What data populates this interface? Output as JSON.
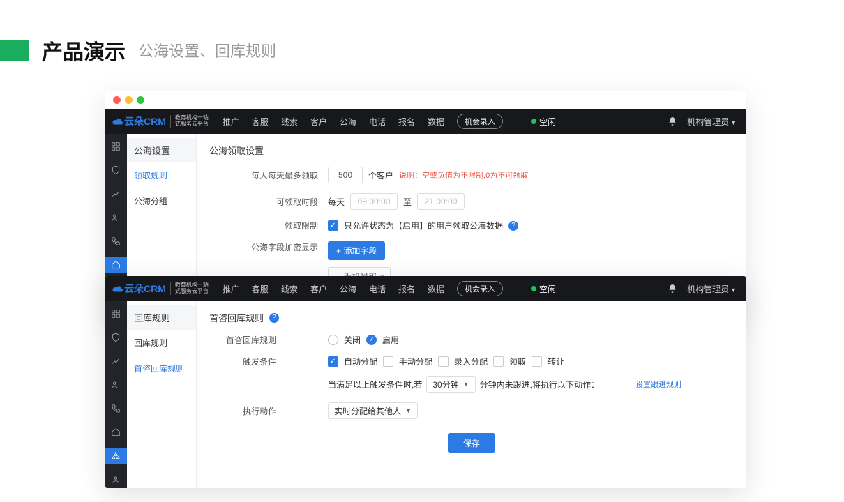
{
  "slide": {
    "title_main": "产品演示",
    "title_sub": "公海设置、回库规则"
  },
  "topnav": [
    "推广",
    "客服",
    "线索",
    "客户",
    "公海",
    "电话",
    "报名",
    "数据"
  ],
  "topnav_pill": "机会录入",
  "status_label": "空闲",
  "user_role": "机构管理员",
  "window1": {
    "sidepanel_title": "公海设置",
    "sidepanel_items": [
      {
        "label": "领取规则",
        "active": true
      },
      {
        "label": "公海分组",
        "active": false
      }
    ],
    "section_title": "公海领取设置",
    "row_limit_label": "每人每天最多领取",
    "row_limit_value": "500",
    "row_limit_unit": "个客户",
    "row_limit_note": "说明：空或负值为不限制,0为不可领取",
    "row_time_label": "可领取时段",
    "row_time_prefix": "每天",
    "row_time_from": "09:00:00",
    "row_time_to_label": "至",
    "row_time_to": "21:00:00",
    "row_restrict_label": "领取限制",
    "row_restrict_text": "只允许状态为【启用】的用户领取公海数据",
    "row_encrypt_label": "公海字段加密显示",
    "row_encrypt_btn": "+ 添加字段",
    "row_encrypt_chip": "手机号码"
  },
  "window2": {
    "sidepanel_title": "回库规则",
    "sidepanel_items": [
      {
        "label": "回库规则",
        "active": false
      },
      {
        "label": "首咨回库规则",
        "active": true
      }
    ],
    "section_title": "首咨回库规则",
    "row_enable_label": "首咨回库规则",
    "radio_off": "关闭",
    "radio_on": "启用",
    "row_trigger_label": "触发条件",
    "trigger_opts": [
      "自动分配",
      "手动分配",
      "录入分配",
      "领取",
      "转让"
    ],
    "trigger_checked": [
      true,
      false,
      false,
      false,
      false
    ],
    "exec_prefix": "当满足以上触发条件时,若",
    "exec_select": "30分钟",
    "exec_mid": "分钟内未跟进,将执行以下动作：",
    "exec_link": "设置跟进规则",
    "row_action_label": "执行动作",
    "action_select": "实时分配给其他人",
    "save_btn": "保存"
  }
}
